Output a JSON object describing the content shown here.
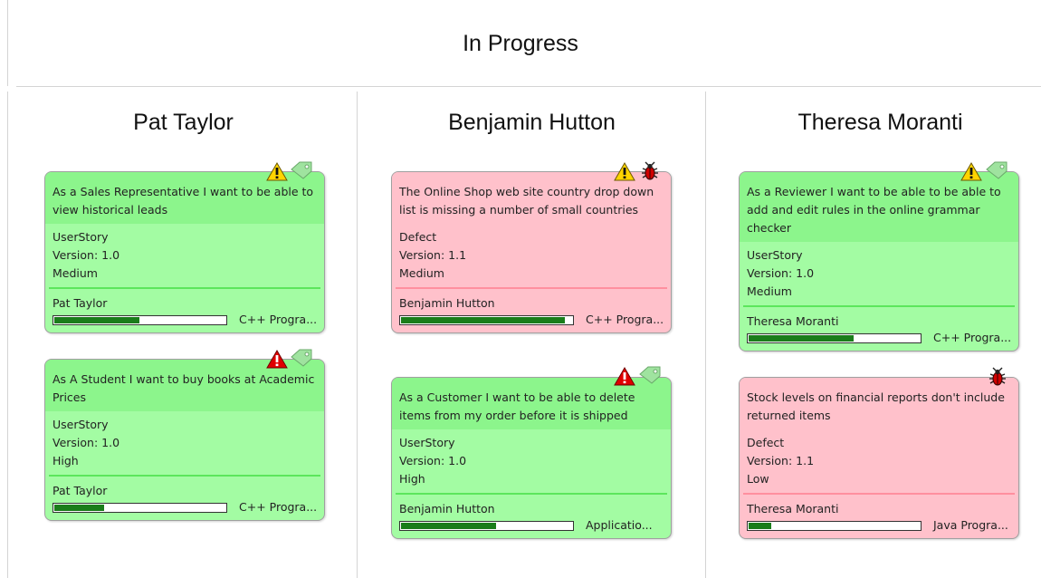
{
  "board": {
    "title": "In Progress"
  },
  "lanes": [
    {
      "name": "Pat Taylor",
      "cards": [
        {
          "title": "As a Sales Representative I want to be able to view historical leads",
          "type": "UserStory",
          "version": "Version: 1.0",
          "priority": "Medium",
          "owner": "Pat Taylor",
          "task": "C++ Progra...",
          "progress_pct": 50,
          "color": "green",
          "icons": [
            "warning-yellow-icon",
            "tag-icon"
          ]
        },
        {
          "title": "As A Student I want to buy books at Academic Prices",
          "type": "UserStory",
          "version": "Version: 1.0",
          "priority": "High",
          "owner": "Pat Taylor",
          "task": "C++ Progra...",
          "progress_pct": 30,
          "color": "green",
          "icons": [
            "warning-red-icon",
            "tag-icon"
          ]
        }
      ]
    },
    {
      "name": "Benjamin Hutton",
      "cards": [
        {
          "title": "The Online Shop web site country drop down list is missing a number of small countries",
          "type": "Defect",
          "version": "Version: 1.1",
          "priority": "Medium",
          "owner": "Benjamin Hutton",
          "task": "C++ Progra...",
          "progress_pct": 96,
          "color": "red",
          "icons": [
            "warning-yellow-icon",
            "bug-icon"
          ]
        },
        {
          "title": "As a Customer I want to be able to delete items from my order before it is shipped",
          "type": "UserStory",
          "version": "Version: 1.0",
          "priority": "High",
          "owner": "Benjamin Hutton",
          "task": "Applicatio...",
          "progress_pct": 56,
          "color": "green",
          "icons": [
            "warning-red-icon",
            "tag-icon"
          ]
        }
      ]
    },
    {
      "name": "Theresa Moranti",
      "cards": [
        {
          "title": "As a Reviewer I want to be able to be able to add and edit rules in the online grammar checker",
          "type": "UserStory",
          "version": "Version: 1.0",
          "priority": "Medium",
          "owner": "Theresa Moranti",
          "task": "C++ Progra...",
          "progress_pct": 62,
          "color": "green",
          "icons": [
            "warning-yellow-icon",
            "tag-icon"
          ]
        },
        {
          "title": "Stock levels on financial reports don't include returned items",
          "type": "Defect",
          "version": "Version: 1.1",
          "priority": "Low",
          "owner": "Theresa Moranti",
          "task": "Java Progra...",
          "progress_pct": 14,
          "color": "red",
          "icons": [
            "bug-icon"
          ]
        }
      ]
    }
  ],
  "colors": {
    "card_green": "#a3fca3",
    "card_green_title": "#8cf58c",
    "card_red": "#ffc1cb",
    "progress_fill": "#1a7d1a",
    "warning_yellow": "#ffd400",
    "warning_red": "#e00000"
  }
}
